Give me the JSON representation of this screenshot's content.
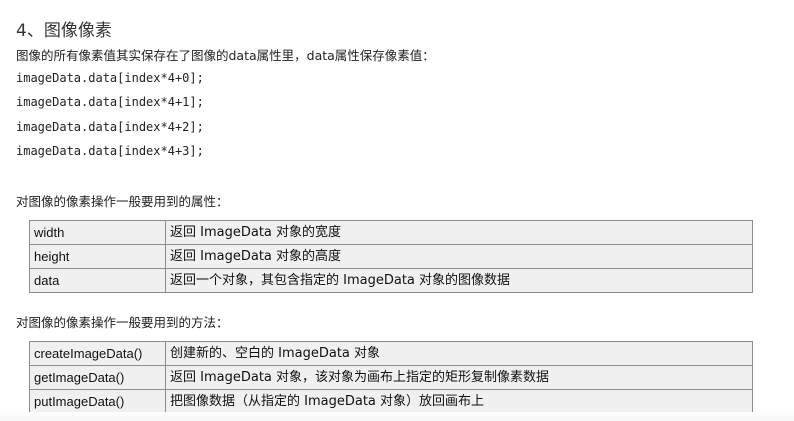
{
  "heading": "4、图像像素",
  "intro": "图像的所有像素值其实保存在了图像的data属性里，data属性保存像素值：",
  "code_lines": [
    "imageData.data[index*4+0];",
    "imageData.data[index*4+1];",
    "imageData.data[index*4+2];",
    "imageData.data[index*4+3];"
  ],
  "attributes_label": "对图像的像素操作一般要用到的属性：",
  "attributes": [
    {
      "name": "width",
      "desc": "返回 ImageData 对象的宽度"
    },
    {
      "name": "height",
      "desc": "返回 ImageData 对象的高度"
    },
    {
      "name": "data",
      "desc": "返回一个对象，其包含指定的 ImageData 对象的图像数据"
    }
  ],
  "methods_label": "对图像的像素操作一般要用到的方法：",
  "methods": [
    {
      "name": "createImageData()",
      "desc": "创建新的、空白的 ImageData 对象"
    },
    {
      "name": "getImageData()",
      "desc": "返回 ImageData 对象，该对象为画布上指定的矩形复制像素数据"
    },
    {
      "name": "putImageData()",
      "desc": "把图像数据（从指定的 ImageData 对象）放回画布上"
    }
  ]
}
